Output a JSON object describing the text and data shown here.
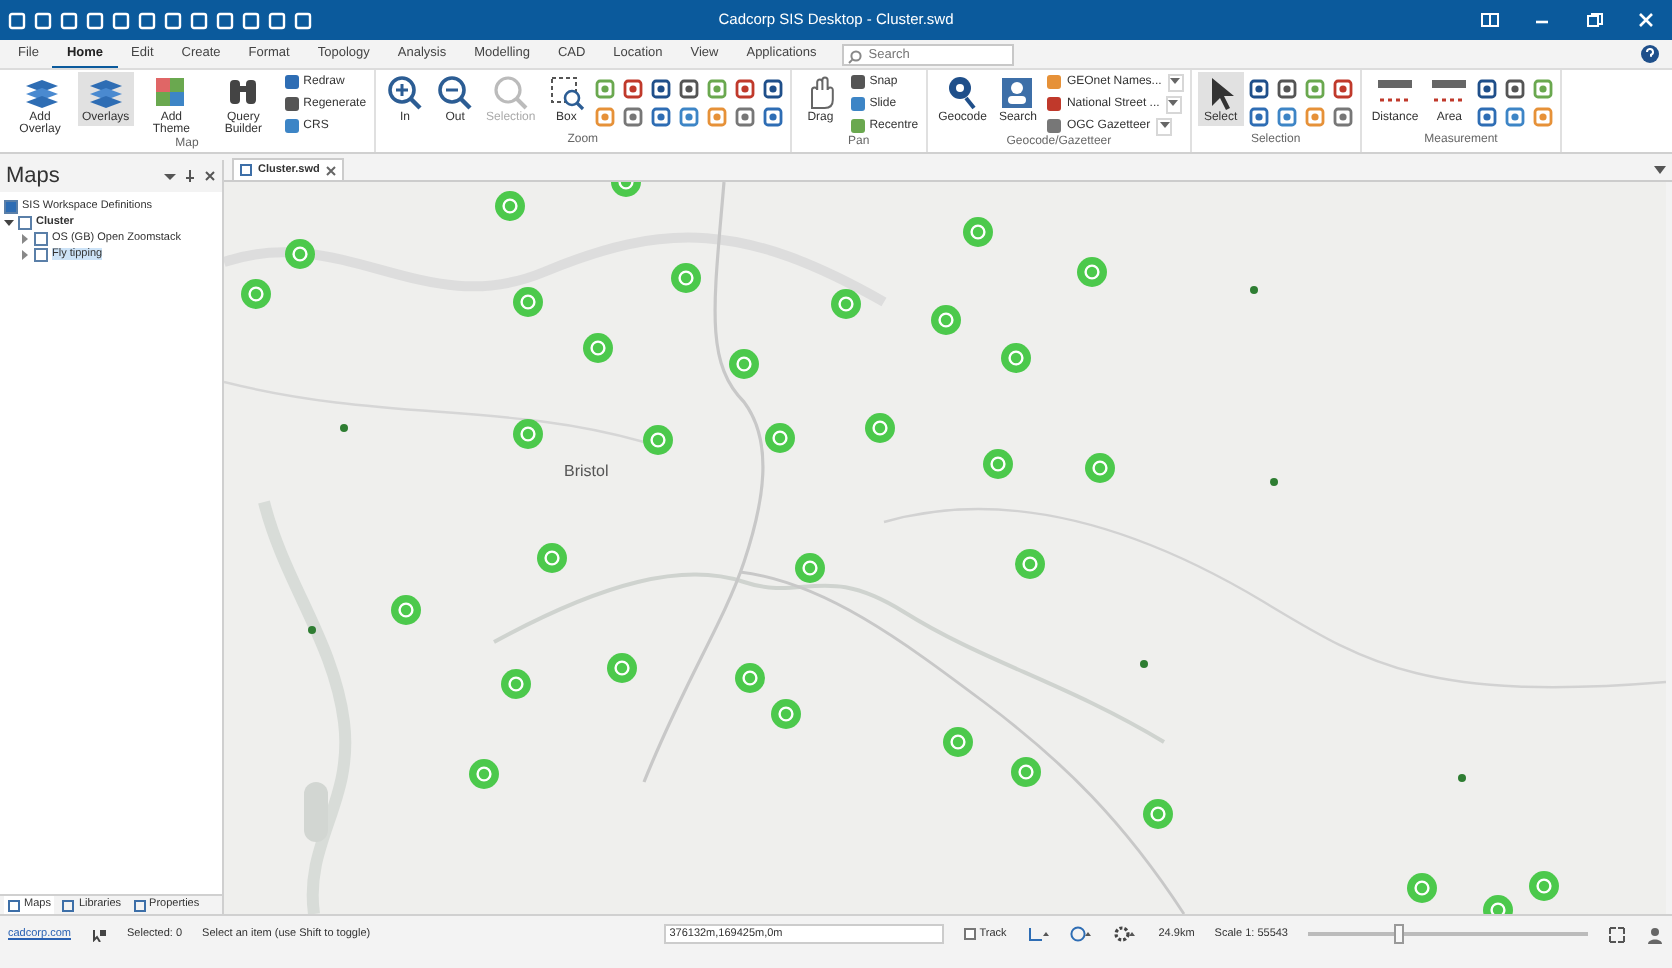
{
  "window": {
    "title": "Cadcorp SIS Desktop - Cluster.swd"
  },
  "menu_tabs": [
    {
      "label": "File",
      "selected": false
    },
    {
      "label": "Home",
      "selected": true
    },
    {
      "label": "Edit",
      "selected": false
    },
    {
      "label": "Create",
      "selected": false
    },
    {
      "label": "Format",
      "selected": false
    },
    {
      "label": "Topology",
      "selected": false
    },
    {
      "label": "Analysis",
      "selected": false
    },
    {
      "label": "Modelling",
      "selected": false
    },
    {
      "label": "CAD",
      "selected": false
    },
    {
      "label": "Location",
      "selected": false
    },
    {
      "label": "View",
      "selected": false
    },
    {
      "label": "Applications",
      "selected": false
    }
  ],
  "search": {
    "placeholder": "Search"
  },
  "ribbon_groups": [
    {
      "title": "Map",
      "buttons": [
        {
          "kind": "large",
          "label": "Add Overlay",
          "selected": false,
          "disabled": false
        },
        {
          "kind": "large",
          "label": "Overlays",
          "selected": true,
          "disabled": false
        },
        {
          "kind": "large",
          "label": "Add Theme",
          "selected": false,
          "disabled": false
        },
        {
          "kind": "large",
          "label": "Query Builder",
          "selected": false,
          "disabled": false
        },
        {
          "kind": "small",
          "label": "Redraw",
          "selected": false,
          "disabled": false
        },
        {
          "kind": "small",
          "label": "Regenerate",
          "selected": false,
          "disabled": false
        },
        {
          "kind": "small",
          "label": "CRS",
          "selected": false,
          "disabled": false
        }
      ]
    },
    {
      "title": "Zoom",
      "buttons": [
        {
          "kind": "large",
          "label": "In",
          "selected": false,
          "disabled": false
        },
        {
          "kind": "large",
          "label": "Out",
          "selected": false,
          "disabled": false
        },
        {
          "kind": "large",
          "label": "Selection",
          "selected": false,
          "disabled": true
        },
        {
          "kind": "large",
          "label": "Box",
          "selected": false,
          "disabled": false
        },
        {
          "kind": "icon",
          "selected": false,
          "disabled": false
        },
        {
          "kind": "icon",
          "selected": false,
          "disabled": false
        },
        {
          "kind": "icon",
          "selected": false,
          "disabled": false
        },
        {
          "kind": "icon",
          "selected": false,
          "disabled": false
        },
        {
          "kind": "icon",
          "selected": false,
          "disabled": false
        },
        {
          "kind": "icon",
          "selected": false,
          "disabled": false
        },
        {
          "kind": "icon",
          "selected": false,
          "disabled": false
        },
        {
          "kind": "icon",
          "selected": false,
          "disabled": false
        },
        {
          "kind": "icon",
          "selected": false,
          "disabled": false
        },
        {
          "kind": "icon",
          "selected": false,
          "disabled": false
        },
        {
          "kind": "icon",
          "selected": false,
          "disabled": false
        },
        {
          "kind": "icon",
          "selected": false,
          "disabled": false
        },
        {
          "kind": "icon",
          "selected": false,
          "disabled": false
        },
        {
          "kind": "icon",
          "selected": false,
          "disabled": false
        }
      ]
    },
    {
      "title": "Pan",
      "buttons": [
        {
          "kind": "large",
          "label": "Drag",
          "selected": false,
          "disabled": false
        },
        {
          "kind": "small",
          "label": "Snap",
          "selected": false,
          "disabled": false
        },
        {
          "kind": "small",
          "label": "Slide",
          "selected": false,
          "disabled": false
        },
        {
          "kind": "small",
          "label": "Recentre",
          "selected": false,
          "disabled": false
        }
      ]
    },
    {
      "title": "Geocode/Gazetteer",
      "buttons": [
        {
          "kind": "large",
          "label": "Geocode",
          "selected": false,
          "disabled": false
        },
        {
          "kind": "large",
          "label": "Search",
          "selected": false,
          "disabled": false
        },
        {
          "kind": "drop",
          "label": "GEOnet Names...",
          "selected": false,
          "disabled": false
        },
        {
          "kind": "drop",
          "label": "National Street ...",
          "selected": false,
          "disabled": false
        },
        {
          "kind": "drop",
          "label": "OGC Gazetteer",
          "selected": false,
          "disabled": false
        }
      ]
    },
    {
      "title": "Selection",
      "buttons": [
        {
          "kind": "large",
          "label": "Select",
          "selected": true,
          "disabled": false
        },
        {
          "kind": "icon",
          "selected": false,
          "disabled": false
        },
        {
          "kind": "icon",
          "selected": false,
          "disabled": false
        },
        {
          "kind": "icon",
          "selected": false,
          "disabled": false
        },
        {
          "kind": "icon",
          "selected": false,
          "disabled": false
        },
        {
          "kind": "icon",
          "selected": false,
          "disabled": false
        },
        {
          "kind": "icon",
          "selected": false,
          "disabled": false
        },
        {
          "kind": "icon",
          "selected": false,
          "disabled": false
        },
        {
          "kind": "icon",
          "selected": false,
          "disabled": false
        }
      ]
    },
    {
      "title": "Measurement",
      "buttons": [
        {
          "kind": "large",
          "label": "Distance",
          "selected": false,
          "disabled": false
        },
        {
          "kind": "large",
          "label": "Area",
          "selected": false,
          "disabled": false
        },
        {
          "kind": "icon",
          "selected": false,
          "disabled": false
        },
        {
          "kind": "icon",
          "selected": false,
          "disabled": false
        },
        {
          "kind": "icon",
          "selected": false,
          "disabled": false
        },
        {
          "kind": "icon",
          "selected": false,
          "disabled": false
        },
        {
          "kind": "icon",
          "selected": false,
          "disabled": false
        },
        {
          "kind": "icon",
          "selected": false,
          "disabled": false
        }
      ]
    }
  ],
  "maps_panel": {
    "title": "Maps",
    "tree": [
      {
        "label": "SIS Workspace Definitions",
        "bold": false,
        "selected": false
      },
      {
        "label": "Cluster",
        "bold": true,
        "expanded": true,
        "selected": false,
        "children": [
          {
            "label": "OS (GB) Open Zoomstack",
            "bold": false,
            "expanded": false,
            "selected": false
          },
          {
            "label": "Fly tipping",
            "bold": false,
            "expanded": false,
            "selected": true
          }
        ]
      }
    ]
  },
  "panel_tabs": [
    {
      "label": "Maps",
      "selected": true
    },
    {
      "label": "Libraries",
      "selected": false
    },
    {
      "label": "Properties",
      "selected": false
    }
  ],
  "document_tab": {
    "label": "Cluster.swd"
  },
  "map": {
    "place_label": "Bristol"
  },
  "status_bar": {
    "link": "cadcorp.com",
    "selected": "Selected: 0",
    "message": "Select an item (use Shift to toggle)",
    "coordinates": "376132m,169425m,0m",
    "track": {
      "label": "Track",
      "checked": false
    },
    "distance": "24.9km",
    "scale": "Scale 1: 55543",
    "zoom_slider": {
      "level": 0.33
    }
  }
}
